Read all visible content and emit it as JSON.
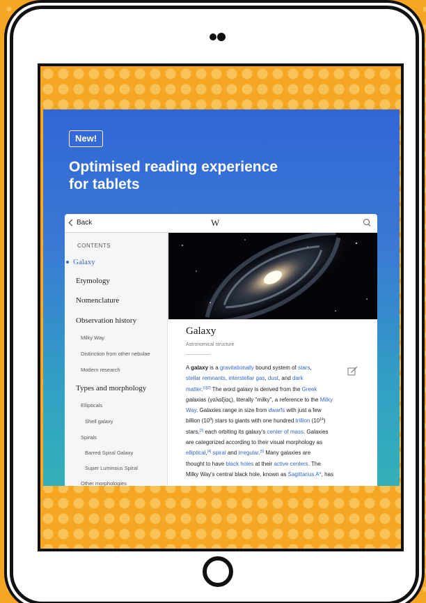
{
  "promo": {
    "badge": "New!",
    "headline_line1": "Optimised reading experience",
    "headline_line2": "for tablets"
  },
  "app_bar": {
    "back_label": "Back",
    "logo": "W",
    "icons": {
      "back": "chevron-left-icon",
      "search": "search-icon"
    }
  },
  "sidebar": {
    "title": "CONTENTS",
    "items": [
      {
        "label": "Galaxy",
        "level": 1,
        "active": true
      },
      {
        "label": "Etymology",
        "level": 1
      },
      {
        "label": "Nomenclature",
        "level": 1
      },
      {
        "label": "Observation history",
        "level": 1
      },
      {
        "label": "Milky Way",
        "level": 2
      },
      {
        "label": "Distinction from other nebulae",
        "level": 2
      },
      {
        "label": "Modern research",
        "level": 2
      },
      {
        "label": "Types and morphology",
        "level": 1
      },
      {
        "label": "Ellipticals",
        "level": 2
      },
      {
        "label": "Shell galaxy",
        "level": 3
      },
      {
        "label": "Spirals",
        "level": 2
      },
      {
        "label": "Barred Spiral Galaxy",
        "level": 3
      },
      {
        "label": "Super Luminous Spiral",
        "level": 3
      },
      {
        "label": "Other morphologies",
        "level": 2
      }
    ]
  },
  "article": {
    "title": "Galaxy",
    "subtitle": "Astronomical structure",
    "icons": {
      "edit": "edit-icon"
    },
    "lines": [
      [
        {
          "t": "A "
        },
        {
          "t": "galaxy",
          "b": true
        },
        {
          "t": " is a "
        },
        {
          "t": "gravitationally",
          "l": true
        },
        {
          "t": " bound system of "
        },
        {
          "t": "stars",
          "l": true
        },
        {
          "t": ","
        }
      ],
      [
        {
          "t": "stellar remnants",
          "l": true
        },
        {
          "t": ", "
        },
        {
          "t": "interstellar gas",
          "l": true
        },
        {
          "t": ", "
        },
        {
          "t": "dust",
          "l": true
        },
        {
          "t": ", and "
        },
        {
          "t": "dark",
          "l": true
        }
      ],
      [
        {
          "t": "matter",
          "l": true
        },
        {
          "t": "."
        },
        {
          "t": "[1][2]",
          "sup": true,
          "l": true
        },
        {
          "t": " The word galaxy is derived from the "
        },
        {
          "t": "Greek",
          "l": true
        }
      ],
      [
        {
          "t": "galaxias",
          "i": true
        },
        {
          "t": " (γαλαξίας), literally \"milky\", a reference to the "
        },
        {
          "t": "Milky",
          "l": true
        }
      ],
      [
        {
          "t": "Way",
          "l": true
        },
        {
          "t": ". Galaxies range in size from "
        },
        {
          "t": "dwarfs",
          "l": true
        },
        {
          "t": " with just a few"
        }
      ],
      [
        {
          "t": "billion (10"
        },
        {
          "t": "9",
          "sup": true
        },
        {
          "t": ") stars to giants with one hundred "
        },
        {
          "t": "trillion",
          "l": true
        },
        {
          "t": " (10"
        },
        {
          "t": "14",
          "sup": true
        },
        {
          "t": ")"
        }
      ],
      [
        {
          "t": "stars,"
        },
        {
          "t": "[3]",
          "sup": true,
          "l": true
        },
        {
          "t": " each orbiting its galaxy's "
        },
        {
          "t": "center of mass",
          "l": true
        },
        {
          "t": ". Galaxies"
        }
      ],
      [
        {
          "t": "are categorized according to their visual morphology as"
        }
      ],
      [
        {
          "t": "elliptical",
          "l": true
        },
        {
          "t": ","
        },
        {
          "t": "[4]",
          "sup": true,
          "l": true
        },
        {
          "t": " "
        },
        {
          "t": "spiral",
          "l": true
        },
        {
          "t": " and "
        },
        {
          "t": "irregular",
          "l": true
        },
        {
          "t": "."
        },
        {
          "t": "[5]",
          "sup": true,
          "l": true
        },
        {
          "t": " Many galaxies are"
        }
      ],
      [
        {
          "t": "thought to have "
        },
        {
          "t": "black holes",
          "l": true
        },
        {
          "t": " at their "
        },
        {
          "t": "active centers",
          "l": true
        },
        {
          "t": ". The"
        }
      ],
      [
        {
          "t": "Milky Way's central black hole, known as "
        },
        {
          "t": "Sagittarius A*",
          "l": true
        },
        {
          "t": ", has"
        }
      ]
    ]
  },
  "colors": {
    "background_orange": "#f5a623",
    "promo_blue": "#3166d6",
    "promo_teal": "#34b0b8",
    "link_blue": "#3366cc"
  }
}
